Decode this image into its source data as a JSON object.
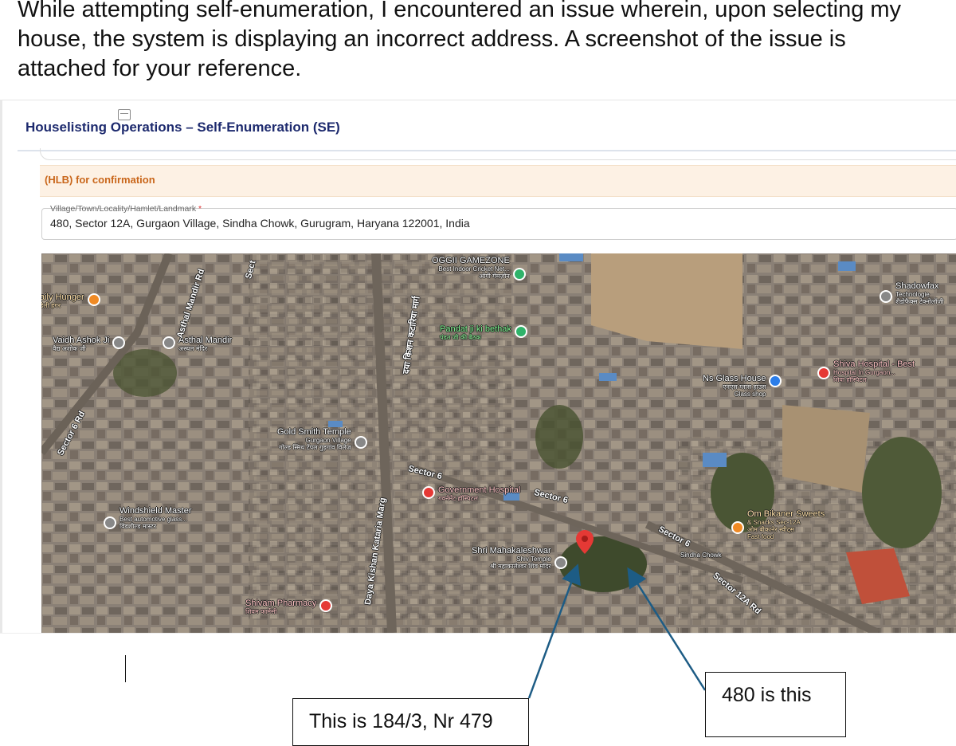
{
  "intro": {
    "text": "While attempting self-enumeration, I encountered an issue wherein, upon selecting my house, the system is displaying an incorrect address. A screenshot of the issue is attached for your reference."
  },
  "form": {
    "title": "Houselisting Operations – Self-Enumeration (SE)",
    "hlb_note": "(HLB) for confirmation",
    "locality_label": "Village/Town/Locality/Hamlet/Landmark",
    "required_mark": "*",
    "locality_value": "480, Sector 12A, Gurgaon Village, Sindha Chowk, Gurugram, Haryana 122001, India"
  },
  "map": {
    "places": [
      {
        "name": "OGGII GAMEZONE",
        "sub": "Best Indoor Cricket Net...",
        "hindi": "ओगी गेमज़ोन",
        "icon": "place-icon",
        "color": "#2fb36a"
      },
      {
        "name": "aily Hunger",
        "hindi": "डेली हंगर",
        "icon": "restaurant-icon",
        "color": "#f08a24"
      },
      {
        "name": "Vaidh Ashok Ji",
        "hindi": "वैद्य अशोक जी",
        "icon": "place-icon",
        "color": "#888888"
      },
      {
        "name": "Asthal Mandir",
        "hindi": "अस्थल मंदिर",
        "icon": "temple-icon",
        "color": "#888888"
      },
      {
        "name": "Pandat ji ki bethak",
        "hindi": "पंडत जी की बैठक",
        "icon": "park-icon",
        "color": "#2fb36a"
      },
      {
        "name": "Gold Smith Temple",
        "sub": "Gurgaon Village",
        "hindi": "गोल्ड स्मिथ टेंपल गुड़गांव विलेज",
        "icon": "temple-icon",
        "color": "#888888"
      },
      {
        "name": "Government Hospital",
        "hindi": "गवर्नमेंट हॉस्पिटल",
        "icon": "hospital-icon",
        "color": "#e53935"
      },
      {
        "name": "Windshield Master",
        "sub": "Best automotive glass...",
        "hindi": "विंडशील्ड मास्टर",
        "icon": "place-icon",
        "color": "#888888"
      },
      {
        "name": "Shri Mahakaleshwar",
        "sub": "Shiv Temple",
        "hindi": "श्री महाकालेश्वर शिव मंदिर",
        "icon": "temple-icon",
        "color": "#888888"
      },
      {
        "name": "Shivam Pharmacy",
        "hindi": "शिवम फार्मेसी",
        "icon": "pharmacy-icon",
        "color": "#e53935"
      },
      {
        "name": "Ns Glass House",
        "sub": "Glass shop",
        "hindi": "एनएस ग्लास हाउस",
        "icon": "shop-icon",
        "color": "#2b7de9"
      },
      {
        "name": "Shiva Hospital - Best",
        "sub": "Hospital In Gurgaon...",
        "hindi": "शिवा हॉस्पिटल",
        "icon": "hospital-icon",
        "color": "#e53935"
      },
      {
        "name": "Shadowfax",
        "sub": "Technologie",
        "hindi": "शैडोफैक्स टेक्नोलॉजी",
        "icon": "place-icon",
        "color": "#888888"
      },
      {
        "name": "Om Bikaner Sweets",
        "sub": "& Snacks Sec-12A",
        "hindi": "ओम बीकानेर स्वीट्स",
        "extra": "Fast food",
        "icon": "restaurant-icon",
        "color": "#f08a24"
      }
    ],
    "roads": {
      "asthal_mandir_rd": "Asthal Mandir Rd",
      "sector6_rd": "Sector 6 Rd",
      "sect": "Sect",
      "daya_kishan": "Daya Kishan Kataria Marg",
      "daya_kishan_hindi": "दया किशन कटारिया मार्ग",
      "sector6_a": "Sector 6",
      "sector6_b": "Sector 6",
      "sector6_c": "Sector 6",
      "sector12a_rd": "Sector 12A Rd",
      "sindha_chowk": "Sindha Chowk"
    }
  },
  "annotations": {
    "note1": "This is 184/3, Nr 479",
    "note2": "480 is this"
  },
  "colors": {
    "title": "#1d2a6e",
    "hlb_text": "#c9661a",
    "hlb_bg": "#fdf1e4",
    "arrow": "#1d5c85",
    "marker": "#e53935"
  }
}
